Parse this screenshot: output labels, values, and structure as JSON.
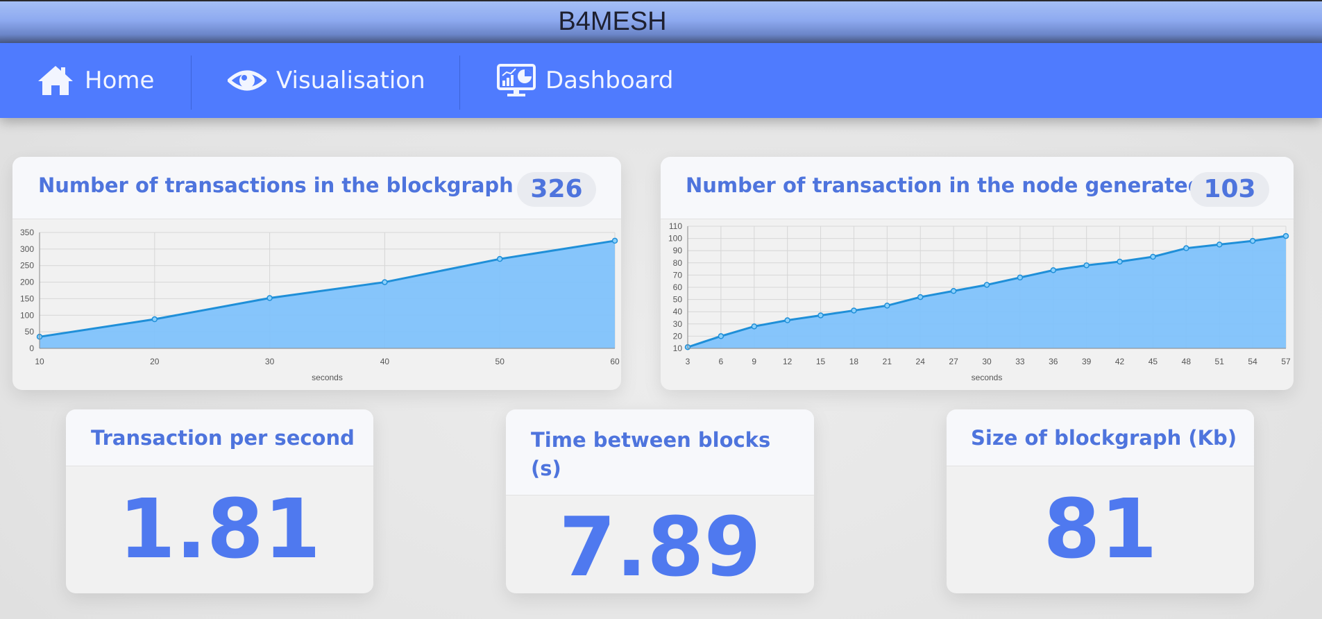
{
  "app": {
    "title": "B4MESH"
  },
  "nav": {
    "items": [
      {
        "label": "Home",
        "icon": "home-icon"
      },
      {
        "label": "Visualisation",
        "icon": "eye-icon"
      },
      {
        "label": "Dashboard",
        "icon": "dashboard-icon"
      }
    ]
  },
  "cards": {
    "blockgraph": {
      "title": "Number of transactions in the blockgraph",
      "badge": "326"
    },
    "node": {
      "title": "Number of transaction in the node generated",
      "badge": "103"
    },
    "tps": {
      "title": "Transaction per second",
      "value": "1.81"
    },
    "tbb": {
      "title": "Time between blocks (s)",
      "value": "7.89"
    },
    "size": {
      "title": "Size of blockgraph (Kb)",
      "value": "81"
    }
  },
  "colors": {
    "accent": "#4f7bfe",
    "title_text": "#4e74dd",
    "line": "#1f8fd8",
    "fill": "#7fc2fb"
  },
  "chart_data": [
    {
      "type": "area",
      "title": "Number of transactions in the blockgraph",
      "xlabel": "seconds",
      "ylabel": "",
      "x": [
        10,
        20,
        30,
        40,
        50,
        60
      ],
      "y": [
        35,
        88,
        152,
        200,
        270,
        325
      ],
      "xlim": [
        10,
        60
      ],
      "ylim": [
        0,
        350
      ],
      "yticks": [
        0,
        50,
        100,
        150,
        200,
        250,
        300,
        350
      ],
      "xticks": [
        10,
        20,
        30,
        40,
        50,
        60
      ],
      "grid": true
    },
    {
      "type": "area",
      "title": "Number of transaction in the node generated",
      "xlabel": "seconds",
      "ylabel": "",
      "x": [
        3,
        6,
        9,
        12,
        15,
        18,
        21,
        24,
        27,
        30,
        33,
        36,
        39,
        42,
        45,
        48,
        51,
        54,
        57
      ],
      "y": [
        11,
        20,
        28,
        33,
        37,
        41,
        45,
        52,
        57,
        62,
        68,
        74,
        78,
        81,
        85,
        92,
        95,
        98,
        102
      ],
      "xlim": [
        3,
        57
      ],
      "ylim": [
        10,
        110
      ],
      "yticks": [
        10,
        20,
        30,
        40,
        50,
        60,
        70,
        80,
        90,
        100,
        110
      ],
      "xticks": [
        3,
        6,
        9,
        12,
        15,
        18,
        21,
        24,
        27,
        30,
        33,
        36,
        39,
        42,
        45,
        48,
        51,
        54,
        57
      ],
      "grid": true
    }
  ]
}
